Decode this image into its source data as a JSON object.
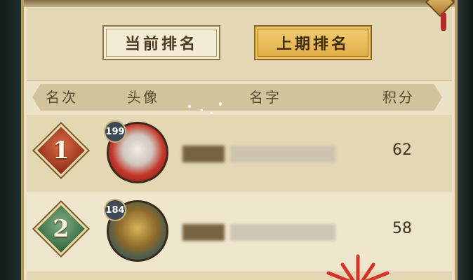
{
  "tabs": {
    "current_label": "当前排名",
    "previous_label": "上期排名",
    "selected": "上期排名"
  },
  "columns": {
    "rank": "名次",
    "avatar": "头像",
    "name": "名字",
    "score": "积分"
  },
  "rows": [
    {
      "rank": "1",
      "level": "199",
      "score": "62",
      "badge_color": "#b3472a"
    },
    {
      "rank": "2",
      "level": "184",
      "score": "58",
      "badge_color": "#4e8a5a"
    }
  ],
  "colors": {
    "panel": "#ebe2c8",
    "tab_active": "#e8b955",
    "text": "#4a3b22"
  }
}
